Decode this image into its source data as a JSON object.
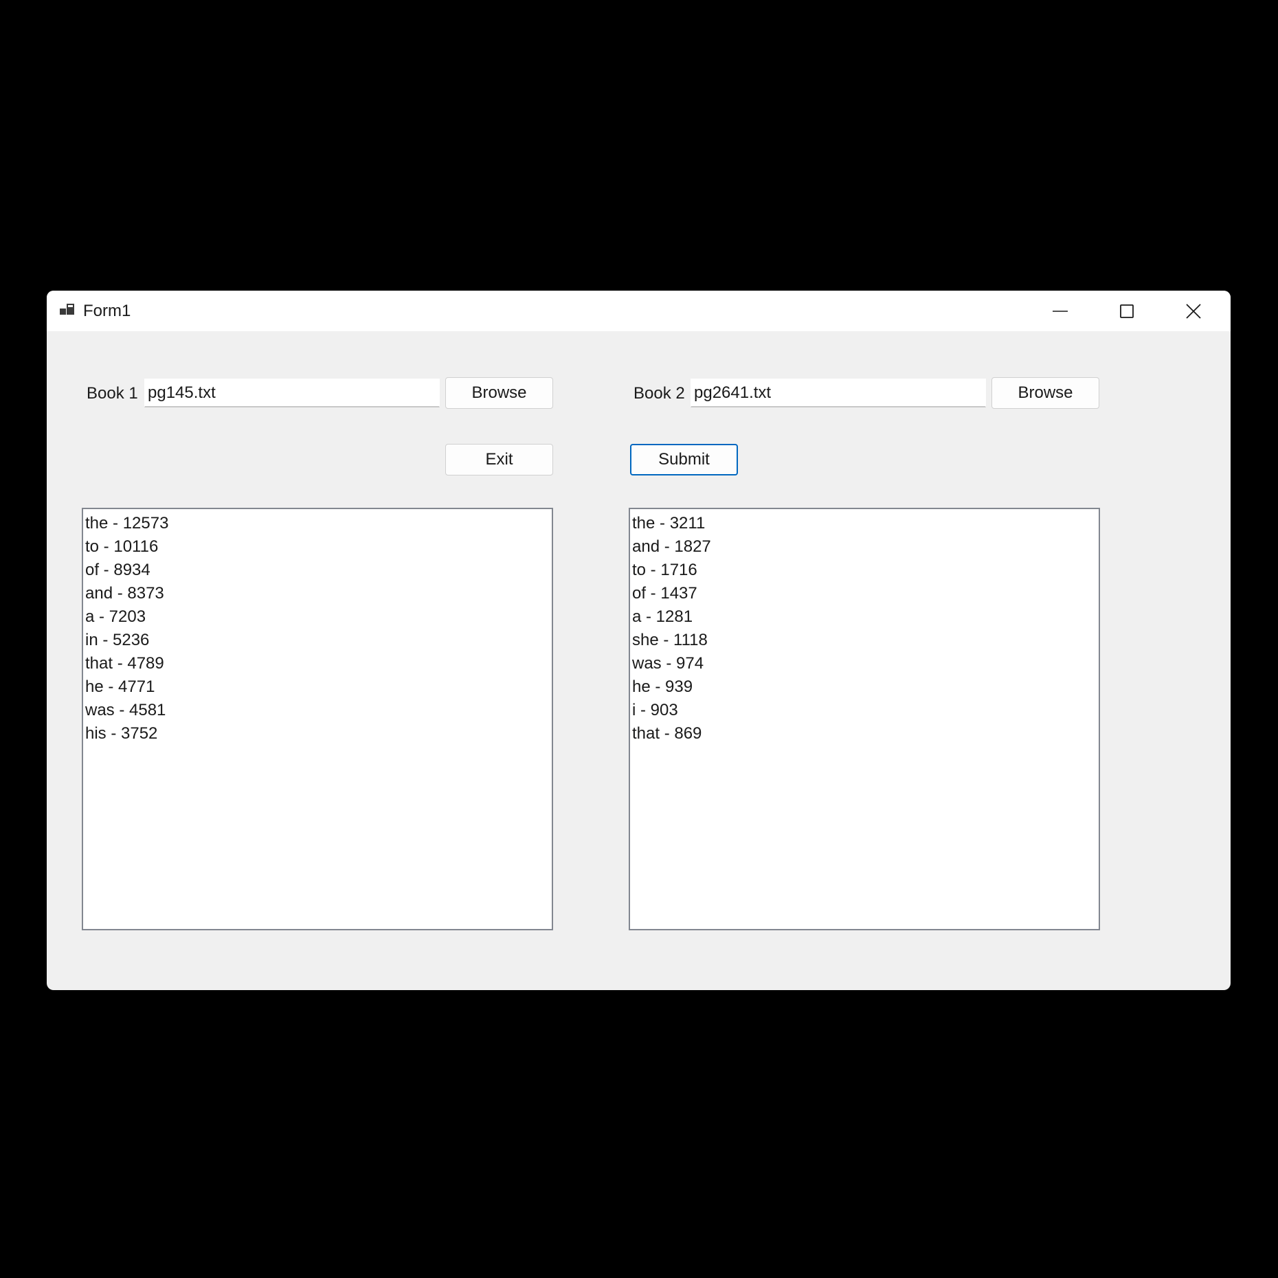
{
  "window": {
    "title": "Form1",
    "controls": {
      "minimize_icon": "minimize-icon",
      "maximize_icon": "maximize-icon",
      "close_icon": "close-icon"
    }
  },
  "book1": {
    "label": "Book 1",
    "value": "pg145.txt",
    "browse_label": "Browse",
    "words": [
      "the - 12573",
      "to - 10116",
      "of - 8934",
      "and - 8373",
      "a - 7203",
      "in - 5236",
      "that - 4789",
      "he - 4771",
      "was - 4581",
      "his - 3752"
    ]
  },
  "book2": {
    "label": "Book 2",
    "value": "pg2641.txt",
    "browse_label": "Browse",
    "words": [
      "the - 3211",
      "and - 1827",
      "to - 1716",
      "of - 1437",
      "a - 1281",
      "she - 1118",
      "was - 974",
      "he - 939",
      "i - 903",
      "that - 869"
    ]
  },
  "actions": {
    "exit_label": "Exit",
    "submit_label": "Submit"
  },
  "colors": {
    "accent": "#0067c0",
    "form_background": "#f0f0f0",
    "titlebar_background": "#ffffff"
  }
}
